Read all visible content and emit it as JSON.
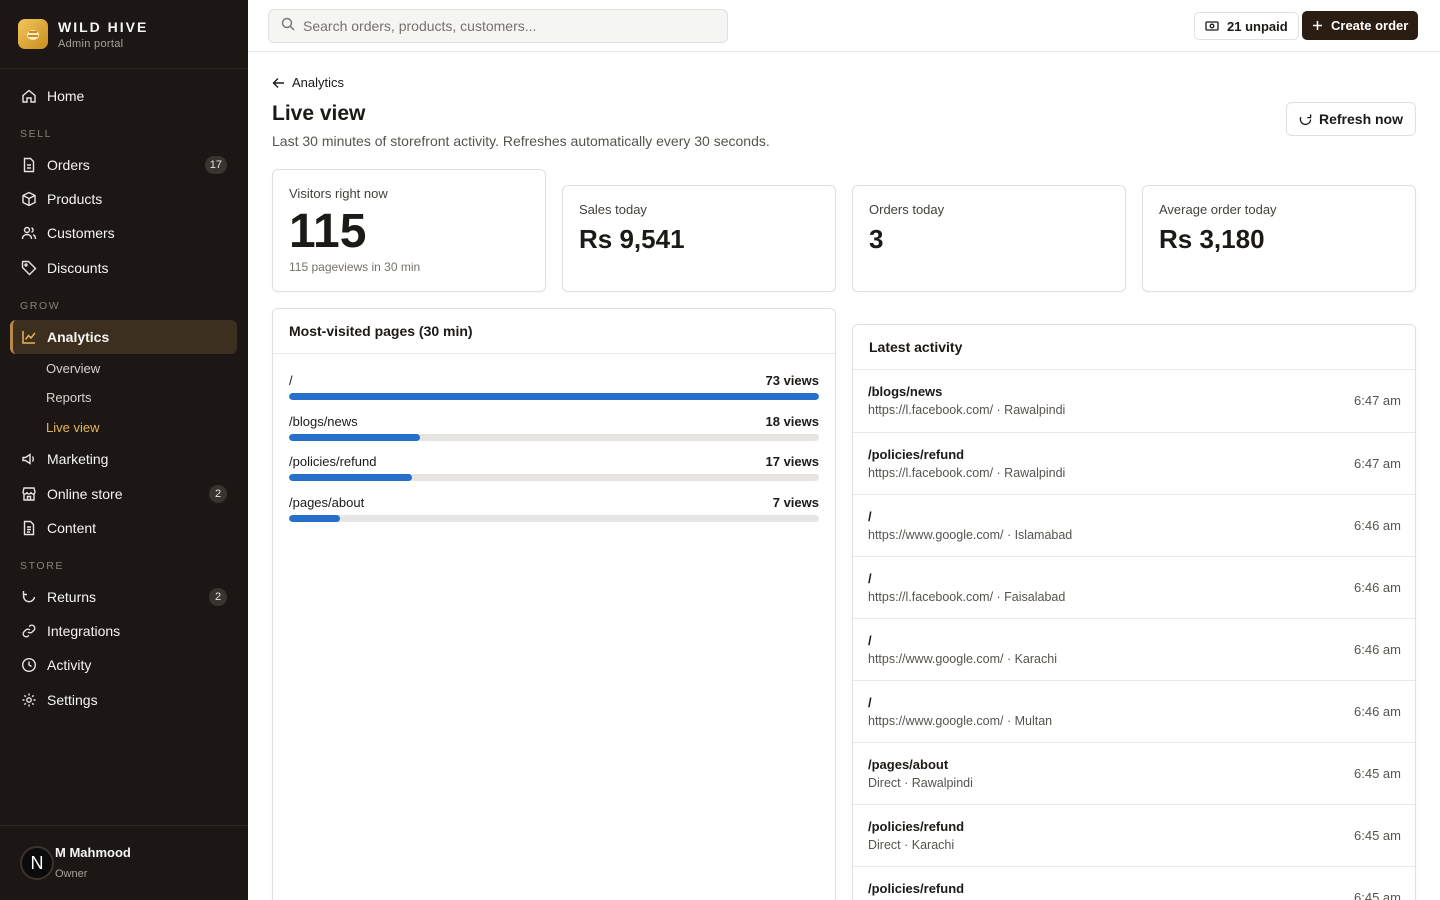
{
  "brand": {
    "name": "WILD HIVE",
    "subtitle": "Admin portal"
  },
  "nav": {
    "home": "Home",
    "sell_label": "SELL",
    "orders": {
      "label": "Orders",
      "badge": "17"
    },
    "products": "Products",
    "customers": "Customers",
    "discounts": "Discounts",
    "grow_label": "GROW",
    "analytics": "Analytics",
    "analytics_sub": [
      "Overview",
      "Reports",
      "Live view"
    ],
    "marketing": "Marketing",
    "online_store": {
      "label": "Online store",
      "badge": "2"
    },
    "content": "Content",
    "store_label": "STORE",
    "returns": {
      "label": "Returns",
      "badge": "2"
    },
    "integrations": "Integrations",
    "activity": "Activity",
    "settings": "Settings"
  },
  "user": {
    "initial": "N",
    "name": "M Mahmood",
    "role": "Owner"
  },
  "topbar": {
    "search_placeholder": "Search orders, products, customers...",
    "unpaid_label": "21 unpaid",
    "create_label": "Create order"
  },
  "header": {
    "back_label": "Analytics",
    "title": "Live view",
    "description": "Last 30 minutes of storefront activity. Refreshes automatically every 30 seconds.",
    "refresh_label": "Refresh now"
  },
  "stats": {
    "visitors": {
      "label": "Visitors right now",
      "value": "115",
      "sub": "115 pageviews in 30 min"
    },
    "sales": {
      "label": "Sales today",
      "value": "Rs 9,541"
    },
    "orders": {
      "label": "Orders today",
      "value": "3"
    },
    "aov": {
      "label": "Average order today",
      "value": "Rs 3,180"
    }
  },
  "top_pages": {
    "title": "Most-visited pages (30 min)",
    "rows": [
      {
        "path": "/",
        "views_label": "73 views",
        "views": 73
      },
      {
        "path": "/blogs/news",
        "views_label": "18 views",
        "views": 18
      },
      {
        "path": "/policies/refund",
        "views_label": "17 views",
        "views": 17
      },
      {
        "path": "/pages/about",
        "views_label": "7 views",
        "views": 7
      }
    ]
  },
  "activity": {
    "title": "Latest activity",
    "rows": [
      {
        "path": "/blogs/news",
        "meta": "https://l.facebook.com/ · Rawalpindi",
        "time": "6:47 am"
      },
      {
        "path": "/policies/refund",
        "meta": "https://l.facebook.com/ · Rawalpindi",
        "time": "6:47 am"
      },
      {
        "path": "/",
        "meta": "https://www.google.com/ · Islamabad",
        "time": "6:46 am"
      },
      {
        "path": "/",
        "meta": "https://l.facebook.com/ · Faisalabad",
        "time": "6:46 am"
      },
      {
        "path": "/",
        "meta": "https://www.google.com/ · Karachi",
        "time": "6:46 am"
      },
      {
        "path": "/",
        "meta": "https://www.google.com/ · Multan",
        "time": "6:46 am"
      },
      {
        "path": "/pages/about",
        "meta": "Direct · Rawalpindi",
        "time": "6:45 am"
      },
      {
        "path": "/policies/refund",
        "meta": "Direct · Karachi",
        "time": "6:45 am"
      },
      {
        "path": "/policies/refund",
        "meta": "",
        "time": "6:45 am"
      }
    ]
  },
  "colors": {
    "accent": "#2670cc",
    "sidebar": "#1c1714",
    "primary_button": "#2b1d12",
    "active_sub": "#e6b55a"
  }
}
